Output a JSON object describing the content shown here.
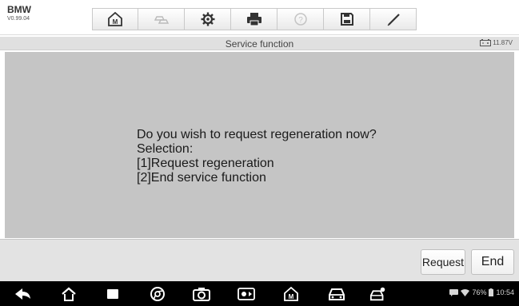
{
  "vehicle": {
    "make": "BMW",
    "version": "V0.99.04"
  },
  "toolbar": {
    "buttons": [
      {
        "name": "home-icon"
      },
      {
        "name": "vehicle-swap-icon"
      },
      {
        "name": "settings-icon"
      },
      {
        "name": "print-icon"
      },
      {
        "name": "help-icon"
      },
      {
        "name": "save-icon"
      },
      {
        "name": "pen-icon"
      }
    ]
  },
  "title_bar": {
    "title": "Service function",
    "battery_voltage": "11.87V"
  },
  "dialog": {
    "lines": [
      "Do you wish to request regeneration now?",
      "Selection:",
      "[1]Request regeneration",
      "[2]End service function"
    ]
  },
  "footer": {
    "request_label": "Request",
    "end_label": "End"
  },
  "navbar": {
    "icons": [
      "back-icon",
      "home-icon",
      "recent-apps-icon",
      "browser-icon",
      "camera-icon",
      "screen-capture-icon",
      "diagnostic-home-icon",
      "car-icon",
      "vci-car-icon"
    ]
  },
  "status": {
    "battery_percent": "76%",
    "time": "10:54"
  },
  "colors": {
    "content_bg": "#c5c5c5",
    "title_bar_bg": "#e0e0e0",
    "footer_bg": "#e3e3e3",
    "navbar_bg": "#000000"
  }
}
